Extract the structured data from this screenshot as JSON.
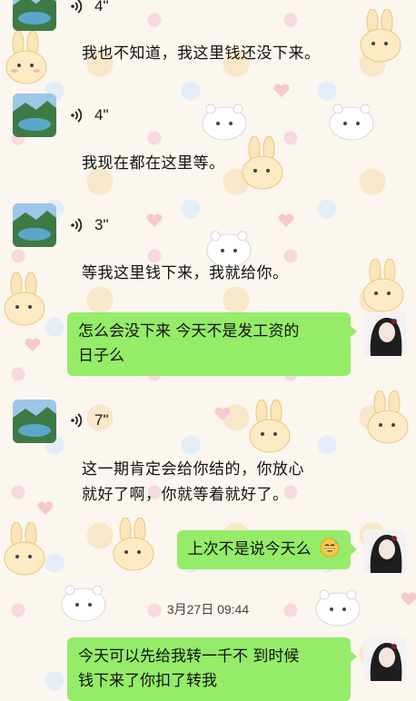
{
  "messages": [
    {
      "voice": "4\"",
      "text": "我也不知道，我这里钱还没下来。"
    },
    {
      "voice": "4\"",
      "text": "我现在都在这里等。"
    },
    {
      "voice": "3\"",
      "text": "等我这里钱下来，我就给你。"
    },
    {
      "outgoing_line1": "怎么会没下来 今天不是发工资的",
      "outgoing_line2": "日子么"
    },
    {
      "voice": "7\"",
      "text_line1": "这一期肯定会给你结的，你放心",
      "text_line2": "就好了啊，你就等着就好了。"
    },
    {
      "outgoing": "上次不是说今天么"
    },
    {
      "timestamp": "3月27日 09:44"
    },
    {
      "outgoing_line1": "今天可以先给我转一千不 到时候",
      "outgoing_line2": "钱下来了你扣了转我"
    }
  ],
  "colors": {
    "bubble_out": "#95ec69",
    "wallpaper": "#fbf6ef"
  },
  "icons": {
    "voice": "voice-wave-icon",
    "grin_sweat": "grinning-sweat-emoji-icon"
  }
}
